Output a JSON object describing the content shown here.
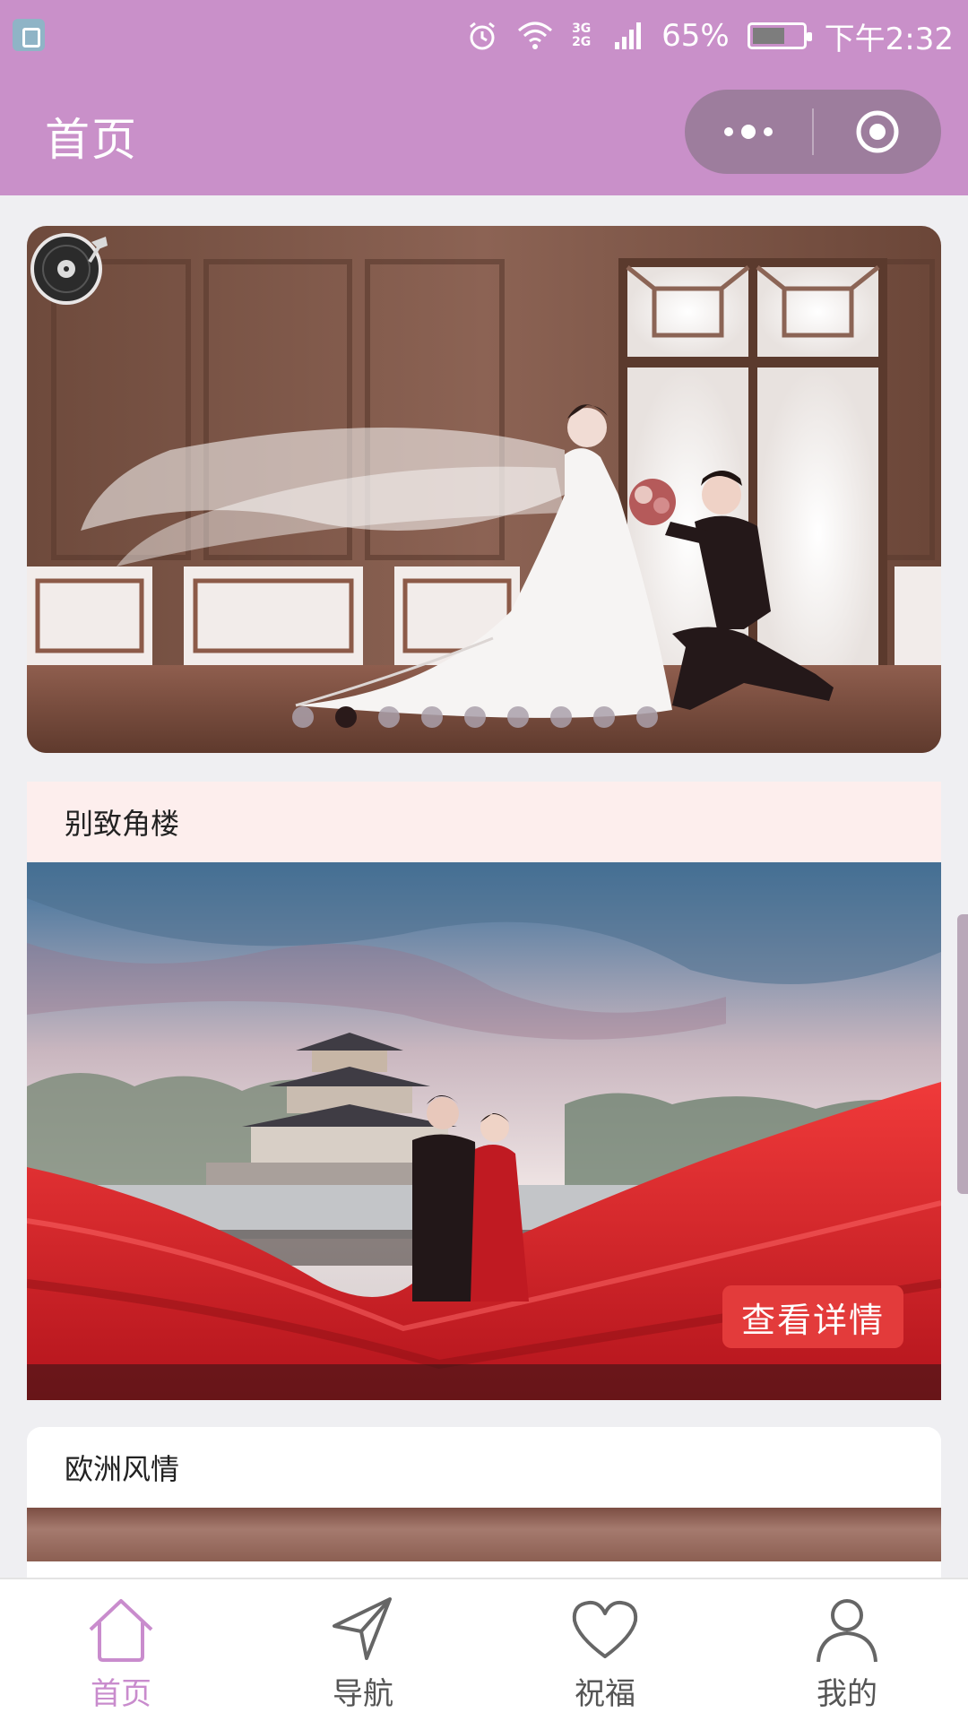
{
  "status_bar": {
    "network": "3G 2G",
    "battery_percent": "65%",
    "time": "下午2:32",
    "battery_level": 0.65
  },
  "nav": {
    "title": "首页",
    "more_icon": "more-dots-icon",
    "close_icon": "target-circle-icon"
  },
  "banner": {
    "slide_count": 9,
    "active_index": 1,
    "music_icon": "vinyl-record-icon"
  },
  "cards": [
    {
      "title": "别致角楼",
      "button": "查看详情"
    },
    {
      "title": "欧洲风情"
    }
  ],
  "tabbar": {
    "items": [
      {
        "label": "首页",
        "icon": "home-icon",
        "active": true
      },
      {
        "label": "导航",
        "icon": "navigation-arrow-icon",
        "active": false
      },
      {
        "label": "祝福",
        "icon": "heart-icon",
        "active": false
      },
      {
        "label": "我的",
        "icon": "user-icon",
        "active": false
      }
    ]
  },
  "colors": {
    "theme": "#c990c9",
    "accent_red": "#e33b3b",
    "tab_active": "#c98ccd"
  }
}
